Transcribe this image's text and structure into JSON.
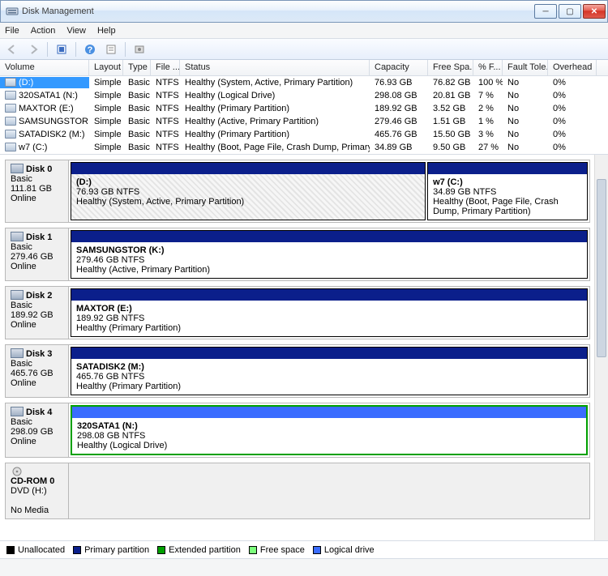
{
  "window": {
    "title": "Disk Management"
  },
  "menu": {
    "file": "File",
    "action": "Action",
    "view": "View",
    "help": "Help"
  },
  "columns": {
    "volume": "Volume",
    "layout": "Layout",
    "type": "Type",
    "fs": "File ...",
    "status": "Status",
    "capacity": "Capacity",
    "free": "Free Spa...",
    "pct": "% F...",
    "fault": "Fault Tole...",
    "overhead": "Overhead"
  },
  "volumes": [
    {
      "name": "(D:)",
      "layout": "Simple",
      "type": "Basic",
      "fs": "NTFS",
      "status": "Healthy (System, Active, Primary Partition)",
      "cap": "76.93 GB",
      "free": "76.82 GB",
      "pct": "100 %",
      "ft": "No",
      "oh": "0%",
      "sel": true
    },
    {
      "name": "320SATA1 (N:)",
      "layout": "Simple",
      "type": "Basic",
      "fs": "NTFS",
      "status": "Healthy (Logical Drive)",
      "cap": "298.08 GB",
      "free": "20.81 GB",
      "pct": "7 %",
      "ft": "No",
      "oh": "0%"
    },
    {
      "name": "MAXTOR (E:)",
      "layout": "Simple",
      "type": "Basic",
      "fs": "NTFS",
      "status": "Healthy (Primary Partition)",
      "cap": "189.92 GB",
      "free": "3.52 GB",
      "pct": "2 %",
      "ft": "No",
      "oh": "0%"
    },
    {
      "name": "SAMSUNGSTOR (K:)",
      "layout": "Simple",
      "type": "Basic",
      "fs": "NTFS",
      "status": "Healthy (Active, Primary Partition)",
      "cap": "279.46 GB",
      "free": "1.51 GB",
      "pct": "1 %",
      "ft": "No",
      "oh": "0%"
    },
    {
      "name": "SATADISK2 (M:)",
      "layout": "Simple",
      "type": "Basic",
      "fs": "NTFS",
      "status": "Healthy (Primary Partition)",
      "cap": "465.76 GB",
      "free": "15.50 GB",
      "pct": "3 %",
      "ft": "No",
      "oh": "0%"
    },
    {
      "name": "w7 (C:)",
      "layout": "Simple",
      "type": "Basic",
      "fs": "NTFS",
      "status": "Healthy (Boot, Page File, Crash Dump, Primary Partition)",
      "cap": "34.89 GB",
      "free": "9.50 GB",
      "pct": "27 %",
      "ft": "No",
      "oh": "0%"
    }
  ],
  "disks": [
    {
      "name": "Disk 0",
      "type": "Basic",
      "cap": "111.81 GB",
      "state": "Online",
      "parts": [
        {
          "name": "(D:)",
          "size": "76.93 GB NTFS",
          "status": "Healthy (System, Active, Primary Partition)",
          "bar": "primary",
          "hatched": true,
          "flex": 69
        },
        {
          "name": "w7  (C:)",
          "size": "34.89 GB NTFS",
          "status": "Healthy (Boot, Page File, Crash Dump, Primary Partition)",
          "bar": "primary",
          "flex": 31
        }
      ]
    },
    {
      "name": "Disk 1",
      "type": "Basic",
      "cap": "279.46 GB",
      "state": "Online",
      "parts": [
        {
          "name": "SAMSUNGSTOR  (K:)",
          "size": "279.46 GB NTFS",
          "status": "Healthy (Active, Primary Partition)",
          "bar": "primary",
          "flex": 100
        }
      ]
    },
    {
      "name": "Disk 2",
      "type": "Basic",
      "cap": "189.92 GB",
      "state": "Online",
      "parts": [
        {
          "name": "MAXTOR  (E:)",
          "size": "189.92 GB NTFS",
          "status": "Healthy (Primary Partition)",
          "bar": "primary",
          "flex": 100
        }
      ]
    },
    {
      "name": "Disk 3",
      "type": "Basic",
      "cap": "465.76 GB",
      "state": "Online",
      "parts": [
        {
          "name": "SATADISK2  (M:)",
          "size": "465.76 GB NTFS",
          "status": "Healthy (Primary Partition)",
          "bar": "primary",
          "flex": 100
        }
      ]
    },
    {
      "name": "Disk 4",
      "type": "Basic",
      "cap": "298.09 GB",
      "state": "Online",
      "extended": true,
      "parts": [
        {
          "name": "320SATA1  (N:)",
          "size": "298.08 GB NTFS",
          "status": "Healthy (Logical Drive)",
          "bar": "logical",
          "flex": 100
        }
      ]
    },
    {
      "name": "CD-ROM 0",
      "type": "DVD (H:)",
      "cap": "",
      "state": "No Media",
      "cdrom": true,
      "parts": []
    }
  ],
  "legend": {
    "unalloc": "Unallocated",
    "primary": "Primary partition",
    "extended": "Extended partition",
    "free": "Free space",
    "logical": "Logical drive"
  }
}
